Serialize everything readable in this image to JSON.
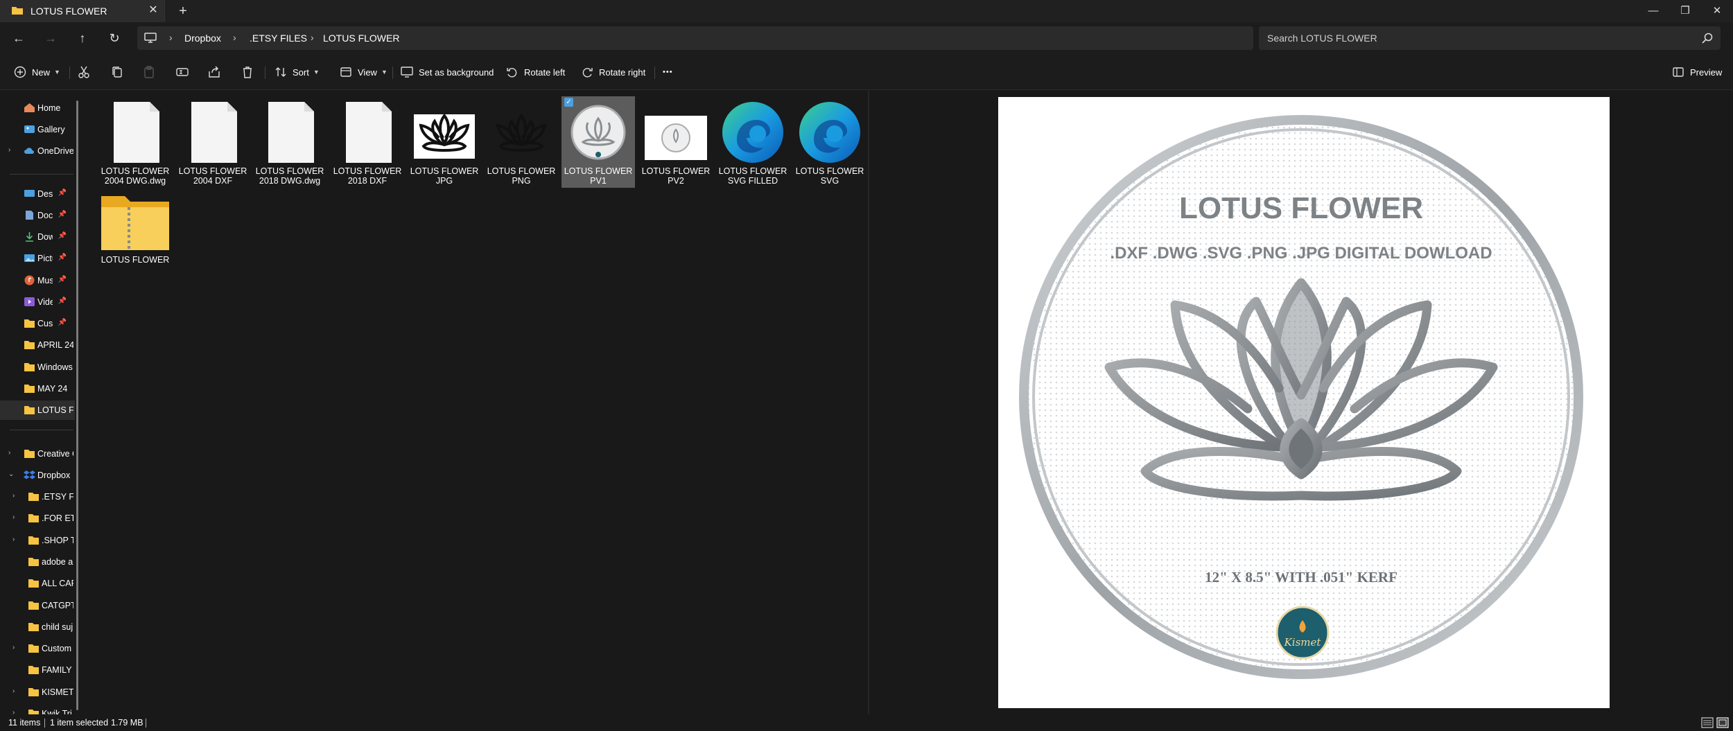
{
  "window": {
    "tab_title": "LOTUS FLOWER",
    "new_tab": "+",
    "close_tab": "✕",
    "minimize": "—",
    "restore": "❐",
    "close": "✕"
  },
  "nav": {
    "back": "←",
    "forward": "→",
    "up": "↑",
    "refresh": "↻"
  },
  "breadcrumb": [
    "Dropbox",
    ".ETSY FILES",
    "LOTUS FLOWER"
  ],
  "breadcrumb_sep": "›",
  "search": {
    "placeholder": "Search LOTUS FLOWER"
  },
  "toolbar": {
    "new_label": "New",
    "sort_label": "Sort",
    "view_label": "View",
    "set_background_label": "Set as background",
    "rotate_left_label": "Rotate left",
    "rotate_right_label": "Rotate right",
    "more_label": "•••",
    "preview_label": "Preview"
  },
  "sidebar": {
    "items": [
      {
        "label": "Home",
        "icon": "home-icon"
      },
      {
        "label": "Gallery",
        "icon": "gallery-icon"
      },
      {
        "label": "OneDrive",
        "icon": "cloud-icon"
      },
      {
        "label": "Deskto",
        "icon": "desktop-icon"
      },
      {
        "label": "Docun",
        "icon": "documents-icon"
      },
      {
        "label": "Downl",
        "icon": "downloads-icon"
      },
      {
        "label": "Picture",
        "icon": "pictures-icon"
      },
      {
        "label": "Music",
        "icon": "music-icon"
      },
      {
        "label": "Videos",
        "icon": "videos-icon"
      },
      {
        "label": "Custor",
        "icon": "folder-icon"
      },
      {
        "label": "APRIL 24",
        "icon": "folder-icon"
      },
      {
        "label": "Windows",
        "icon": "folder-icon"
      },
      {
        "label": "MAY 24",
        "icon": "folder-icon"
      },
      {
        "label": "LOTUS FL",
        "icon": "folder-icon"
      },
      {
        "label": "Creative C",
        "icon": "folder-icon"
      },
      {
        "label": "Dropbox",
        "icon": "dropbox-icon"
      },
      {
        "label": ".ETSY FIL",
        "icon": "folder-icon"
      },
      {
        "label": ".FOR ETS",
        "icon": "folder-icon"
      },
      {
        "label": ".SHOP T",
        "icon": "folder-icon"
      },
      {
        "label": "adobe a",
        "icon": "folder-icon"
      },
      {
        "label": "ALL CAF",
        "icon": "folder-icon"
      },
      {
        "label": "CATGPT",
        "icon": "folder-icon"
      },
      {
        "label": "child suj",
        "icon": "folder-icon"
      },
      {
        "label": "Custom",
        "icon": "folder-icon"
      },
      {
        "label": "FAMILY",
        "icon": "folder-icon"
      },
      {
        "label": "KISMET",
        "icon": "folder-icon"
      },
      {
        "label": "Kwik Tri",
        "icon": "folder-icon"
      }
    ]
  },
  "files": [
    {
      "name": "LOTUS FLOWER 2004 DWG.dwg",
      "type": "blank-file-icon"
    },
    {
      "name": "LOTUS FLOWER 2004 DXF",
      "type": "blank-file-icon"
    },
    {
      "name": "LOTUS FLOWER 2018 DWG.dwg",
      "type": "blank-file-icon"
    },
    {
      "name": "LOTUS FLOWER 2018 DXF",
      "type": "blank-file-icon"
    },
    {
      "name": "LOTUS FLOWER JPG",
      "type": "lotus-thumbnail"
    },
    {
      "name": "LOTUS FLOWER PNG",
      "type": "lotus-thumbnail"
    },
    {
      "name": "LOTUS FLOWER PV1",
      "type": "preview-thumbnail"
    },
    {
      "name": "LOTUS FLOWER PV2",
      "type": "preview-thumbnail"
    },
    {
      "name": "LOTUS FLOWER SVG FILLED",
      "type": "edge-icon"
    },
    {
      "name": "LOTUS FLOWER SVG",
      "type": "edge-icon"
    },
    {
      "name": "LOTUS FLOWER",
      "type": "zip-folder-icon"
    }
  ],
  "preview": {
    "title": "LOTUS FLOWER",
    "formats": ".DXF .DWG .SVG .PNG .JPG DIGITAL DOWLOAD",
    "size": "12\" X 8.5\" WITH .051\" KERF",
    "logo_text": "Kismet"
  },
  "status": {
    "items_count": "11 items",
    "selected": "1 item selected",
    "size": "1.79 MB"
  },
  "colors": {
    "folder": "#f6c343",
    "accent": "#4ca0e0",
    "lotus_gray": "#8a8f93",
    "ring": "#b8bcbf",
    "logo_teal": "#1d5f6d"
  }
}
